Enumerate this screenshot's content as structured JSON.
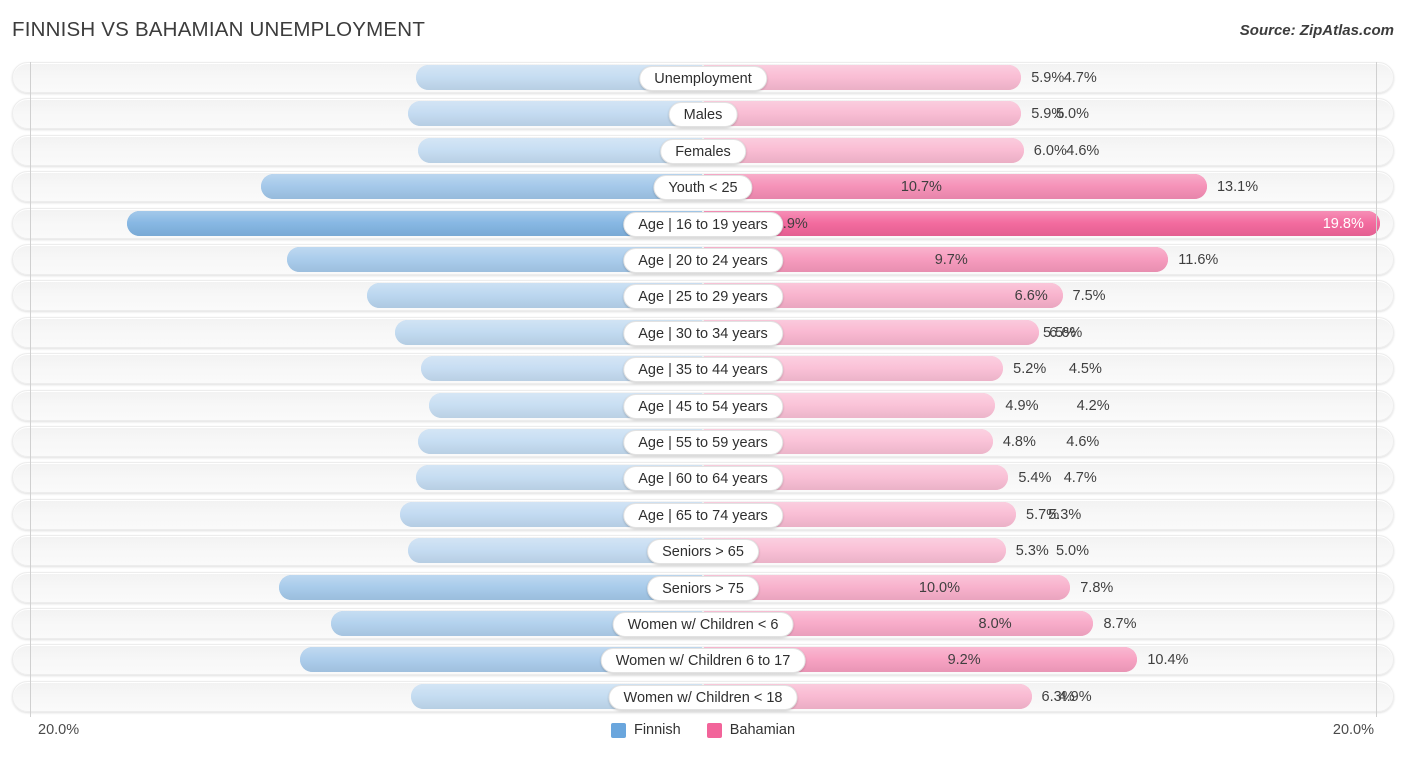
{
  "header": {
    "title": "FINNISH VS BAHAMIAN UNEMPLOYMENT",
    "source": "Source: ZipAtlas.com"
  },
  "axis": {
    "left_max_label": "20.0%",
    "right_max_label": "20.0%"
  },
  "legend": {
    "items": [
      {
        "label": "Finnish",
        "color": "#6aa6dd"
      },
      {
        "label": "Bahamian",
        "color": "#f2649a"
      }
    ]
  },
  "chart_data": {
    "type": "bar",
    "title": "FINNISH VS BAHAMIAN UNEMPLOYMENT",
    "subtitle": "",
    "xlabel": "",
    "ylabel": "",
    "orientation": "horizontal-diverging",
    "axis_max": 20.0,
    "axis_units": "%",
    "grid": true,
    "legend_position": "bottom-center",
    "categories": [
      "Unemployment",
      "Males",
      "Females",
      "Youth < 25",
      "Age | 16 to 19 years",
      "Age | 20 to 24 years",
      "Age | 25 to 29 years",
      "Age | 30 to 34 years",
      "Age | 35 to 44 years",
      "Age | 45 to 54 years",
      "Age | 55 to 59 years",
      "Age | 60 to 64 years",
      "Age | 65 to 74 years",
      "Seniors > 65",
      "Seniors > 75",
      "Women w/ Children < 6",
      "Women w/ Children 6 to 17",
      "Women w/ Children < 18"
    ],
    "series": [
      {
        "name": "Finnish",
        "color": "#6aa6dd",
        "values": [
          4.7,
          5.0,
          4.6,
          10.7,
          15.9,
          9.7,
          6.6,
          5.5,
          4.5,
          4.2,
          4.6,
          4.7,
          5.3,
          5.0,
          10.0,
          8.0,
          9.2,
          4.9
        ],
        "labels": [
          "4.7%",
          "5.0%",
          "4.6%",
          "10.7%",
          "15.9%",
          "9.7%",
          "6.6%",
          "5.5%",
          "4.5%",
          "4.2%",
          "4.6%",
          "4.7%",
          "5.3%",
          "5.0%",
          "10.0%",
          "8.0%",
          "9.2%",
          "4.9%"
        ]
      },
      {
        "name": "Bahamian",
        "color": "#f2649a",
        "values": [
          5.9,
          5.9,
          6.0,
          13.1,
          19.8,
          11.6,
          7.5,
          6.6,
          5.2,
          4.9,
          4.8,
          5.4,
          5.7,
          5.3,
          7.8,
          8.7,
          10.4,
          6.3
        ],
        "labels": [
          "5.9%",
          "5.9%",
          "6.0%",
          "13.1%",
          "19.8%",
          "11.6%",
          "7.5%",
          "6.6%",
          "5.2%",
          "4.9%",
          "4.8%",
          "5.4%",
          "5.7%",
          "5.3%",
          "7.8%",
          "8.7%",
          "10.4%",
          "6.3%"
        ]
      }
    ]
  }
}
